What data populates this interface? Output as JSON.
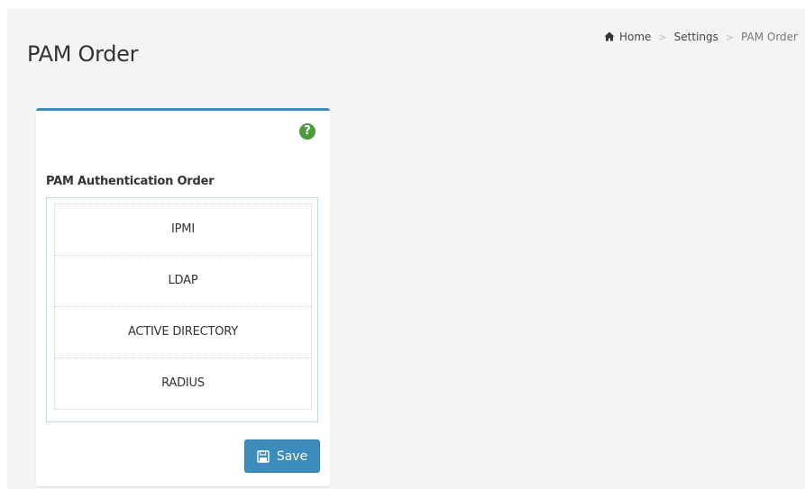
{
  "page": {
    "title": "PAM Order"
  },
  "breadcrumb": {
    "home": "Home",
    "settings": "Settings",
    "current": "PAM Order",
    "separator": ">"
  },
  "form": {
    "label": "PAM Authentication Order",
    "items": [
      "IPMI",
      "LDAP",
      "ACTIVE DIRECTORY",
      "RADIUS"
    ],
    "save_label": "Save"
  },
  "icons": {
    "help": "question-circle-icon",
    "home": "home-icon",
    "save": "floppy-disk-icon"
  },
  "colors": {
    "primary": "#3c8dbc",
    "help_green": "#4b9a3e",
    "list_border": "#b8dced",
    "page_background": "#f4f4f4"
  }
}
